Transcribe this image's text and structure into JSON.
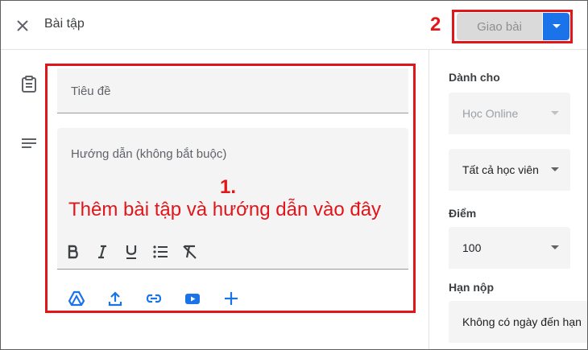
{
  "header": {
    "title": "Bài tập",
    "assign_label": "Giao bài",
    "step_label": "2"
  },
  "form": {
    "title_placeholder": "Tiêu đề",
    "description_placeholder": "Hướng dẫn (không bắt buộc)",
    "step_label": "1.",
    "annotation": "Thêm bài tập và hướng dẫn vào đây"
  },
  "toolbar": {
    "items": [
      "bold-icon",
      "italic-icon",
      "underline-icon",
      "bulleted-list-icon",
      "clear-formatting-icon"
    ]
  },
  "attachments": {
    "items": [
      "google-drive-icon",
      "upload-icon",
      "link-icon",
      "youtube-icon",
      "add-icon"
    ]
  },
  "sidebar": {
    "for_label": "Dành cho",
    "class_value": "Học Online",
    "students_value": "Tất cả học viên",
    "points_label": "Điểm",
    "points_value": "100",
    "due_label": "Hạn nộp",
    "due_value": "Không có ngày đến hạn"
  },
  "colors": {
    "accent": "#1a73e8",
    "annotation_red": "#e0161b",
    "disabled_button": "#dadada"
  }
}
